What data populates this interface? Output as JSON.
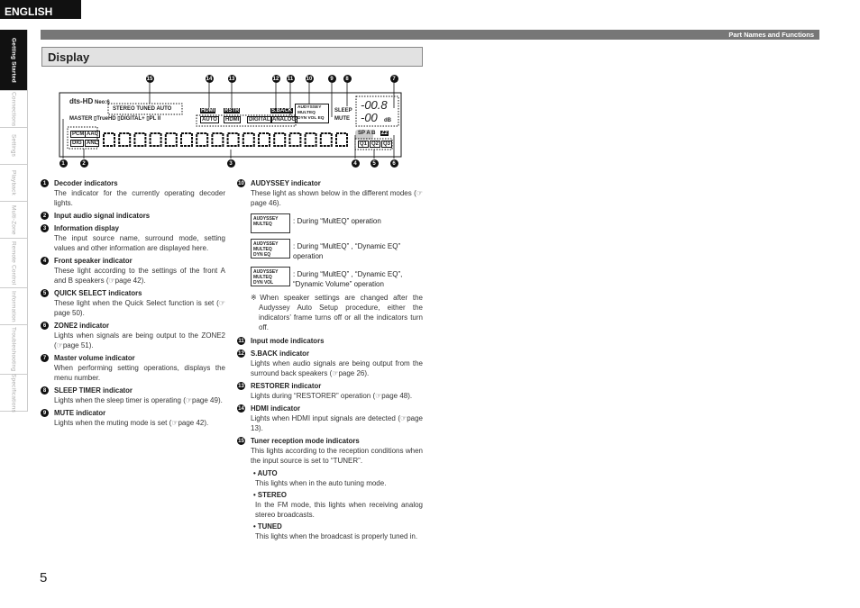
{
  "language": "ENGLISH",
  "section_header": "Part Names and Functions",
  "sidebar": [
    "Getting Started",
    "Connections",
    "Settings",
    "Playback",
    "Multi-Zone",
    "Remote Control",
    "Information",
    "Troubleshooting",
    "Specifications"
  ],
  "heading": "Display",
  "diagram": {
    "top_callouts": [
      "15",
      "14",
      "13",
      "12",
      "11",
      "10",
      "9",
      "8",
      "7"
    ],
    "bottom_callouts": [
      "1",
      "2",
      "3",
      "4",
      "5",
      "6"
    ],
    "labels": {
      "dts": "dts-HD",
      "neo": "Neo:6",
      "tuner": "STEREO  TUNED  AUTO",
      "decoders": "MASTER ▯TrueHD ▯DIGITAL+ ▯PL II",
      "hdmi_ind": "HDMI",
      "auto": "AUTO",
      "rstr": "RSTR",
      "hdmi": "HDMI",
      "digital": "DIGITAL",
      "sback": "S.BACK",
      "analog": "ANALOG",
      "audyssey": "AUDYSSEY",
      "multeq": "MULTEQ",
      "dynvol": "DYN VOL EQ",
      "sleep": "SLEEP",
      "mute": "MUTE",
      "vol1": "-00.8",
      "vol2": "-00",
      "db": "dB",
      "pcm": "PCM",
      "aac": "AAC",
      "dig": "DIG",
      "anl": "ANL",
      "sp": "SP A B",
      "z2": "Z2",
      "q1": "Q1",
      "q2": "Q2",
      "q3": "Q3"
    }
  },
  "left_items": [
    {
      "n": "1",
      "title": "Decoder indicators",
      "body": "The indicator for the currently operating decoder lights."
    },
    {
      "n": "2",
      "title": "Input audio signal indicators",
      "body": ""
    },
    {
      "n": "3",
      "title": "Information display",
      "body": "The input source name, surround mode, setting values and other information are displayed here."
    },
    {
      "n": "4",
      "title": "Front speaker indicator",
      "body": "These light according to the settings of the front A and B speakers (☞page 42)."
    },
    {
      "n": "5",
      "title": "QUICK SELECT indicators",
      "body": "These light when the Quick Select function is set (☞page 50)."
    },
    {
      "n": "6",
      "title": "ZONE2 indicator",
      "body": "Lights when signals are being output to the ZONE2 (☞page 51)."
    },
    {
      "n": "7",
      "title": "Master volume indicator",
      "body": "When performing setting operations, displays the menu number."
    },
    {
      "n": "8",
      "title": "SLEEP TIMER indicator",
      "body": "Lights when the sleep timer is operating (☞page 49)."
    },
    {
      "n": "9",
      "title": "MUTE indicator",
      "body": "Lights when the muting mode is set (☞page 42)."
    }
  ],
  "audyssey": {
    "n": "10",
    "title": "AUDYSSEY indicator",
    "body": "These light as shown below in the different modes (☞page 46).",
    "modes": [
      {
        "lines": [
          "AUDYSSEY",
          "MULTEQ",
          ""
        ],
        "caption": ": During “MultEQ” operation"
      },
      {
        "lines": [
          "AUDYSSEY",
          "MULTEQ",
          "DYN        EQ"
        ],
        "caption": ": During “MultEQ” , “Dynamic EQ” operation"
      },
      {
        "lines": [
          "AUDYSSEY",
          "MULTEQ",
          "DYN VOL"
        ],
        "caption": ": During “MultEQ” , “Dynamic EQ”, “Dynamic Volume” operation"
      }
    ],
    "note": "※When speaker settings are changed after the Audyssey Auto Setup procedure, either the indicators’ frame turns off or all the indicators turn off."
  },
  "right_items": [
    {
      "n": "11",
      "title": "Input mode indicators",
      "body": ""
    },
    {
      "n": "12",
      "title": "S.BACK indicator",
      "body": "Lights when audio signals are being output from the surround back speakers (☞page 26)."
    },
    {
      "n": "13",
      "title": "RESTORER indicator",
      "body": "Lights during “RESTORER” operation (☞page 48)."
    },
    {
      "n": "14",
      "title": "HDMI indicator",
      "body": "Lights when HDMI input signals are detected (☞page 13)."
    },
    {
      "n": "15",
      "title": "Tuner reception mode indicators",
      "body": "This lights according to the reception conditions when the input source is set to “TUNER”."
    }
  ],
  "tuner_bullets": [
    {
      "title": "• AUTO",
      "body": "This lights when in the auto tuning mode."
    },
    {
      "title": "• STEREO",
      "body": "In the FM mode, this lights when receiving analog stereo broadcasts."
    },
    {
      "title": "• TUNED",
      "body": "This lights when the broadcast is properly tuned in."
    }
  ],
  "page_number": "5"
}
